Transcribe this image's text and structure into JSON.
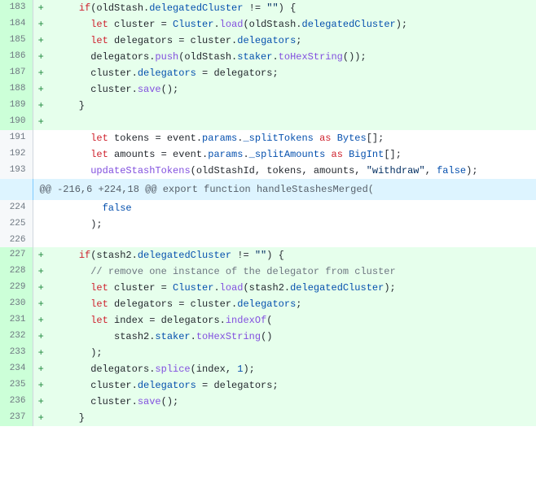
{
  "hunk_header": "@@ -216,6 +224,18 @@ export function handleStashesMerged(",
  "lines": [
    {
      "num": "183",
      "m": "+",
      "a": true,
      "tokens": [
        {
          "t": "    "
        },
        {
          "t": "if",
          "c": "kw"
        },
        {
          "t": "(oldStash."
        },
        {
          "t": "delegatedCluster",
          "c": "prop"
        },
        {
          "t": " != "
        },
        {
          "t": "\"\"",
          "c": "str"
        },
        {
          "t": ") {"
        }
      ]
    },
    {
      "num": "184",
      "m": "+",
      "a": true,
      "tokens": [
        {
          "t": "      "
        },
        {
          "t": "let",
          "c": "kw"
        },
        {
          "t": " cluster = "
        },
        {
          "t": "Cluster",
          "c": "cls"
        },
        {
          "t": "."
        },
        {
          "t": "load",
          "c": "fn"
        },
        {
          "t": "(oldStash."
        },
        {
          "t": "delegatedCluster",
          "c": "prop"
        },
        {
          "t": ");"
        }
      ]
    },
    {
      "num": "185",
      "m": "+",
      "a": true,
      "tokens": [
        {
          "t": "      "
        },
        {
          "t": "let",
          "c": "kw"
        },
        {
          "t": " delegators = cluster."
        },
        {
          "t": "delegators",
          "c": "prop"
        },
        {
          "t": ";"
        }
      ]
    },
    {
      "num": "186",
      "m": "+",
      "a": true,
      "tokens": [
        {
          "t": "      delegators."
        },
        {
          "t": "push",
          "c": "fn"
        },
        {
          "t": "(oldStash."
        },
        {
          "t": "staker",
          "c": "prop"
        },
        {
          "t": "."
        },
        {
          "t": "toHexString",
          "c": "fn"
        },
        {
          "t": "());"
        }
      ]
    },
    {
      "num": "187",
      "m": "+",
      "a": true,
      "tokens": [
        {
          "t": "      cluster."
        },
        {
          "t": "delegators",
          "c": "prop"
        },
        {
          "t": " = delegators;"
        }
      ]
    },
    {
      "num": "188",
      "m": "+",
      "a": true,
      "tokens": [
        {
          "t": "      cluster."
        },
        {
          "t": "save",
          "c": "fn"
        },
        {
          "t": "();"
        }
      ]
    },
    {
      "num": "189",
      "m": "+",
      "a": true,
      "tokens": [
        {
          "t": "    }"
        }
      ]
    },
    {
      "num": "190",
      "m": "+",
      "a": true,
      "tokens": [
        {
          "t": ""
        }
      ]
    },
    {
      "num": "191",
      "m": " ",
      "a": false,
      "tokens": [
        {
          "t": "      "
        },
        {
          "t": "let",
          "c": "kw"
        },
        {
          "t": " tokens = event."
        },
        {
          "t": "params",
          "c": "prop"
        },
        {
          "t": "."
        },
        {
          "t": "_splitTokens",
          "c": "prop"
        },
        {
          "t": " "
        },
        {
          "t": "as",
          "c": "kw"
        },
        {
          "t": " "
        },
        {
          "t": "Bytes",
          "c": "cls"
        },
        {
          "t": "[];"
        }
      ]
    },
    {
      "num": "192",
      "m": " ",
      "a": false,
      "tokens": [
        {
          "t": "      "
        },
        {
          "t": "let",
          "c": "kw"
        },
        {
          "t": " amounts = event."
        },
        {
          "t": "params",
          "c": "prop"
        },
        {
          "t": "."
        },
        {
          "t": "_splitAmounts",
          "c": "prop"
        },
        {
          "t": " "
        },
        {
          "t": "as",
          "c": "kw"
        },
        {
          "t": " "
        },
        {
          "t": "BigInt",
          "c": "cls"
        },
        {
          "t": "[];"
        }
      ]
    },
    {
      "num": "193",
      "m": " ",
      "a": false,
      "tokens": [
        {
          "t": "      "
        },
        {
          "t": "updateStashTokens",
          "c": "fn"
        },
        {
          "t": "(oldStashId, tokens, amounts, "
        },
        {
          "t": "\"withdraw\"",
          "c": "str"
        },
        {
          "t": ", "
        },
        {
          "t": "false",
          "c": "bool"
        },
        {
          "t": ");"
        }
      ]
    }
  ],
  "lines2": [
    {
      "num": "224",
      "m": " ",
      "a": false,
      "tokens": [
        {
          "t": "        "
        },
        {
          "t": "false",
          "c": "bool"
        }
      ]
    },
    {
      "num": "225",
      "m": " ",
      "a": false,
      "tokens": [
        {
          "t": "      );"
        }
      ]
    },
    {
      "num": "226",
      "m": " ",
      "a": false,
      "tokens": [
        {
          "t": ""
        }
      ]
    },
    {
      "num": "227",
      "m": "+",
      "a": true,
      "tokens": [
        {
          "t": "    "
        },
        {
          "t": "if",
          "c": "kw"
        },
        {
          "t": "(stash2."
        },
        {
          "t": "delegatedCluster",
          "c": "prop"
        },
        {
          "t": " != "
        },
        {
          "t": "\"\"",
          "c": "str"
        },
        {
          "t": ") {"
        }
      ]
    },
    {
      "num": "228",
      "m": "+",
      "a": true,
      "tokens": [
        {
          "t": "      "
        },
        {
          "t": "// remove one instance of the delegator from cluster",
          "c": "cmt"
        }
      ]
    },
    {
      "num": "229",
      "m": "+",
      "a": true,
      "tokens": [
        {
          "t": "      "
        },
        {
          "t": "let",
          "c": "kw"
        },
        {
          "t": " cluster = "
        },
        {
          "t": "Cluster",
          "c": "cls"
        },
        {
          "t": "."
        },
        {
          "t": "load",
          "c": "fn"
        },
        {
          "t": "(stash2."
        },
        {
          "t": "delegatedCluster",
          "c": "prop"
        },
        {
          "t": ");"
        }
      ]
    },
    {
      "num": "230",
      "m": "+",
      "a": true,
      "tokens": [
        {
          "t": "      "
        },
        {
          "t": "let",
          "c": "kw"
        },
        {
          "t": " delegators = cluster."
        },
        {
          "t": "delegators",
          "c": "prop"
        },
        {
          "t": ";"
        }
      ]
    },
    {
      "num": "231",
      "m": "+",
      "a": true,
      "tokens": [
        {
          "t": "      "
        },
        {
          "t": "let",
          "c": "kw"
        },
        {
          "t": " index = delegators."
        },
        {
          "t": "indexOf",
          "c": "fn"
        },
        {
          "t": "("
        }
      ]
    },
    {
      "num": "232",
      "m": "+",
      "a": true,
      "tokens": [
        {
          "t": "          stash2."
        },
        {
          "t": "staker",
          "c": "prop"
        },
        {
          "t": "."
        },
        {
          "t": "toHexString",
          "c": "fn"
        },
        {
          "t": "()"
        }
      ]
    },
    {
      "num": "233",
      "m": "+",
      "a": true,
      "tokens": [
        {
          "t": "      );"
        }
      ]
    },
    {
      "num": "234",
      "m": "+",
      "a": true,
      "tokens": [
        {
          "t": "      delegators."
        },
        {
          "t": "splice",
          "c": "fn"
        },
        {
          "t": "(index, "
        },
        {
          "t": "1",
          "c": "num"
        },
        {
          "t": ");"
        }
      ]
    },
    {
      "num": "235",
      "m": "+",
      "a": true,
      "tokens": [
        {
          "t": "      cluster."
        },
        {
          "t": "delegators",
          "c": "prop"
        },
        {
          "t": " = delegators;"
        }
      ]
    },
    {
      "num": "236",
      "m": "+",
      "a": true,
      "tokens": [
        {
          "t": "      cluster."
        },
        {
          "t": "save",
          "c": "fn"
        },
        {
          "t": "();"
        }
      ]
    },
    {
      "num": "237",
      "m": "+",
      "a": true,
      "tokens": [
        {
          "t": "    }"
        }
      ]
    }
  ]
}
